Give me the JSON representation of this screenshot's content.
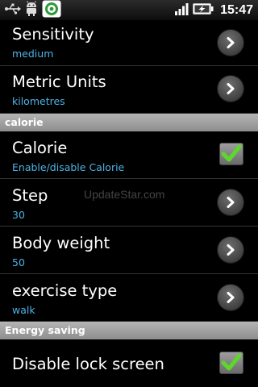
{
  "status_bar": {
    "time": "15:47",
    "left_icons": [
      "usb-icon",
      "android-debug-icon",
      "app-notification-icon"
    ],
    "right_icons": [
      "signal-icon",
      "battery-icon"
    ]
  },
  "preferences": {
    "sensitivity": {
      "title": "Sensitivity",
      "summary": "medium"
    },
    "metric_units": {
      "title": "Metric Units",
      "summary": "kilometres"
    },
    "calorie_category": "calorie",
    "calorie": {
      "title": "Calorie",
      "summary": "Enable/disable Calorie",
      "checked": true
    },
    "step": {
      "title": "Step",
      "summary": "30"
    },
    "body_weight": {
      "title": "Body weight",
      "summary": "50"
    },
    "exercise_type": {
      "title": "exercise type",
      "summary": "walk"
    },
    "energy_category": "Energy saving",
    "disable_lock_screen": {
      "title": "Disable lock screen",
      "checked": true
    }
  },
  "watermark": "UpdateStar.com",
  "colors": {
    "summary_text": "#4db3e6",
    "check_green": "#5cd82a",
    "category_bg": "#a0a0a0"
  }
}
